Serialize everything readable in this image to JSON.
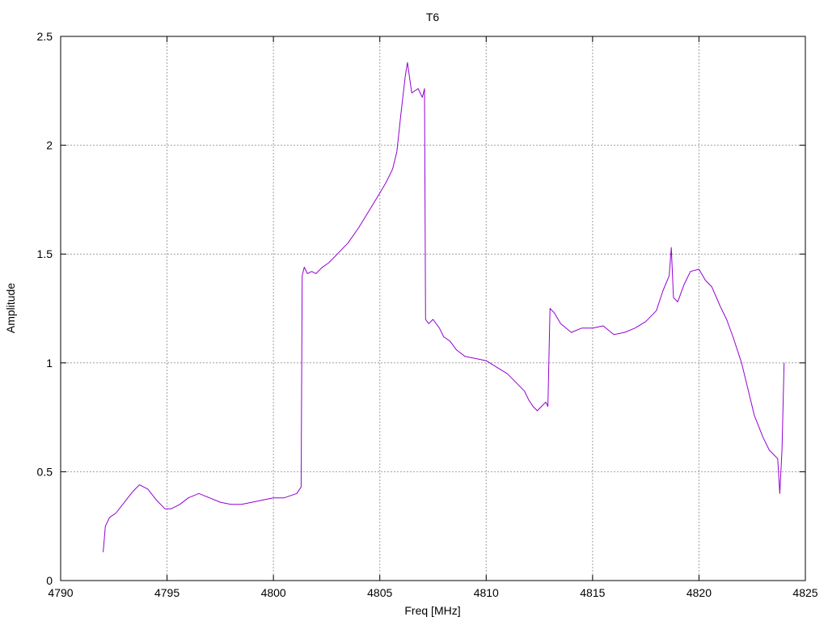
{
  "chart_data": {
    "type": "line",
    "title": "T6",
    "xlabel": "Freq [MHz]",
    "ylabel": "Amplitude",
    "xlim": [
      4790,
      4825
    ],
    "ylim": [
      0,
      2.5
    ],
    "xticks": [
      "4790",
      "4795",
      "4800",
      "4805",
      "4810",
      "4815",
      "4820",
      "4825"
    ],
    "yticks": [
      "0",
      "0.5",
      "1",
      "1.5",
      "2",
      "2.5"
    ],
    "grid": true,
    "series": [
      {
        "color": "#9400d3",
        "x": [
          4792.0,
          4792.1,
          4792.3,
          4792.6,
          4793.0,
          4793.4,
          4793.7,
          4794.1,
          4794.5,
          4794.9,
          4795.2,
          4795.6,
          4796.0,
          4796.5,
          4797.0,
          4797.5,
          4798.0,
          4798.5,
          4799.0,
          4799.5,
          4800.0,
          4800.5,
          4801.1,
          4801.3,
          4801.35,
          4801.45,
          4801.6,
          4801.8,
          4802.0,
          4802.3,
          4802.6,
          4803.0,
          4803.5,
          4804.0,
          4804.5,
          4805.0,
          4805.3,
          4805.6,
          4805.8,
          4806.0,
          4806.2,
          4806.3,
          4806.5,
          4806.8,
          4807.0,
          4807.1,
          4807.15,
          4807.3,
          4807.5,
          4807.8,
          4808.0,
          4808.3,
          4808.6,
          4809.0,
          4809.5,
          4810.0,
          4810.5,
          4811.0,
          4811.5,
          4811.8,
          4812.0,
          4812.2,
          4812.4,
          4812.6,
          4812.8,
          4812.9,
          4813.0,
          4813.2,
          4813.5,
          4814.0,
          4814.5,
          4815.0,
          4815.5,
          4816.0,
          4816.5,
          4817.0,
          4817.5,
          4818.0,
          4818.3,
          4818.6,
          4818.7,
          4818.8,
          4819.0,
          4819.3,
          4819.6,
          4820.0,
          4820.3,
          4820.6,
          4821.0,
          4821.3,
          4821.6,
          4822.0,
          4822.3,
          4822.6,
          4823.0,
          4823.3,
          4823.5,
          4823.7,
          4823.8,
          4823.9,
          4824.0
        ],
        "y": [
          0.13,
          0.25,
          0.29,
          0.31,
          0.36,
          0.41,
          0.44,
          0.42,
          0.37,
          0.33,
          0.33,
          0.35,
          0.38,
          0.4,
          0.38,
          0.36,
          0.35,
          0.35,
          0.36,
          0.37,
          0.38,
          0.38,
          0.4,
          0.43,
          1.4,
          1.44,
          1.41,
          1.42,
          1.41,
          1.44,
          1.46,
          1.5,
          1.55,
          1.62,
          1.7,
          1.78,
          1.83,
          1.89,
          1.97,
          2.15,
          2.32,
          2.38,
          2.24,
          2.26,
          2.22,
          2.26,
          1.2,
          1.18,
          1.2,
          1.16,
          1.12,
          1.1,
          1.06,
          1.03,
          1.02,
          1.01,
          0.98,
          0.95,
          0.9,
          0.87,
          0.83,
          0.8,
          0.78,
          0.8,
          0.82,
          0.8,
          1.25,
          1.23,
          1.18,
          1.14,
          1.16,
          1.16,
          1.17,
          1.13,
          1.14,
          1.16,
          1.19,
          1.24,
          1.33,
          1.4,
          1.53,
          1.3,
          1.28,
          1.36,
          1.42,
          1.43,
          1.38,
          1.35,
          1.26,
          1.2,
          1.12,
          1.0,
          0.88,
          0.76,
          0.66,
          0.6,
          0.58,
          0.56,
          0.4,
          0.6,
          1.0
        ]
      }
    ]
  }
}
